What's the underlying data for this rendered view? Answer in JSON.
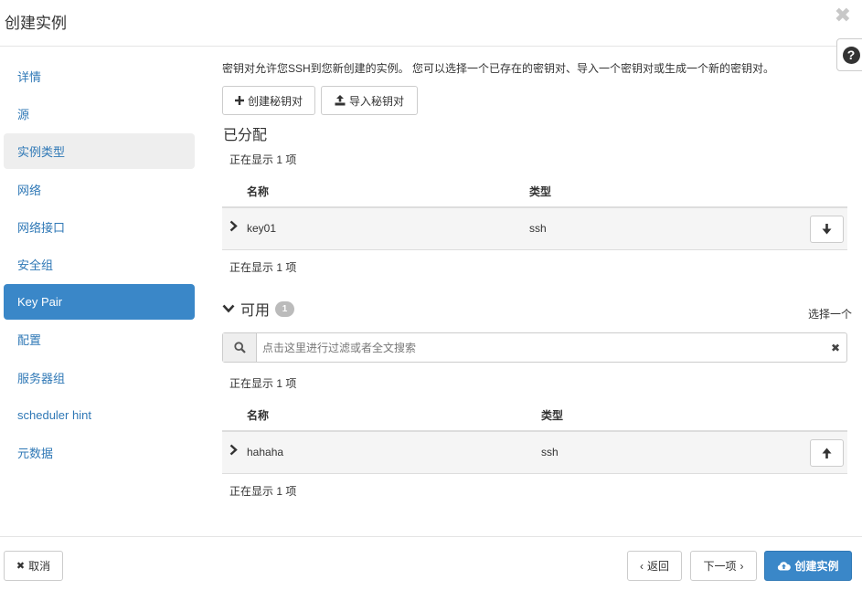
{
  "dialog": {
    "title": "创建实例",
    "close_glyph": "✖",
    "help_glyph": "?"
  },
  "sidebar": {
    "items": [
      {
        "label": "详情"
      },
      {
        "label": "源"
      },
      {
        "label": "实例类型"
      },
      {
        "label": "网络"
      },
      {
        "label": "网络接口"
      },
      {
        "label": "安全组"
      },
      {
        "label": "Key Pair"
      },
      {
        "label": "配置"
      },
      {
        "label": "服务器组"
      },
      {
        "label": "scheduler hint"
      },
      {
        "label": "元数据"
      }
    ]
  },
  "content": {
    "description": "密钥对允许您SSH到您新创建的实例。 您可以选择一个已存在的密钥对、导入一个密钥对或生成一个新的密钥对。",
    "create_keypair_label": "创建秘钥对",
    "import_keypair_label": "导入秘钥对",
    "allocated": {
      "title": "已分配",
      "count_top": "正在显示 1 项",
      "columns": [
        "名称",
        "类型"
      ],
      "rows": [
        {
          "name": "key01",
          "type": "ssh"
        }
      ],
      "count_bottom": "正在显示 1 项"
    },
    "available": {
      "title": "可用",
      "badge": "1",
      "select_one": "选择一个",
      "search_placeholder": "点击这里进行过滤或者全文搜索",
      "count_top": "正在显示 1 项",
      "columns": [
        "名称",
        "类型"
      ],
      "rows": [
        {
          "name": "hahaha",
          "type": "ssh"
        }
      ],
      "count_bottom": "正在显示 1 项"
    }
  },
  "footer": {
    "cancel_label": "取消",
    "back_label": "返回",
    "next_label": "下一项",
    "create_label": "创建实例"
  },
  "colors": {
    "accent": "#3a87c8",
    "link": "#2f78b6"
  }
}
